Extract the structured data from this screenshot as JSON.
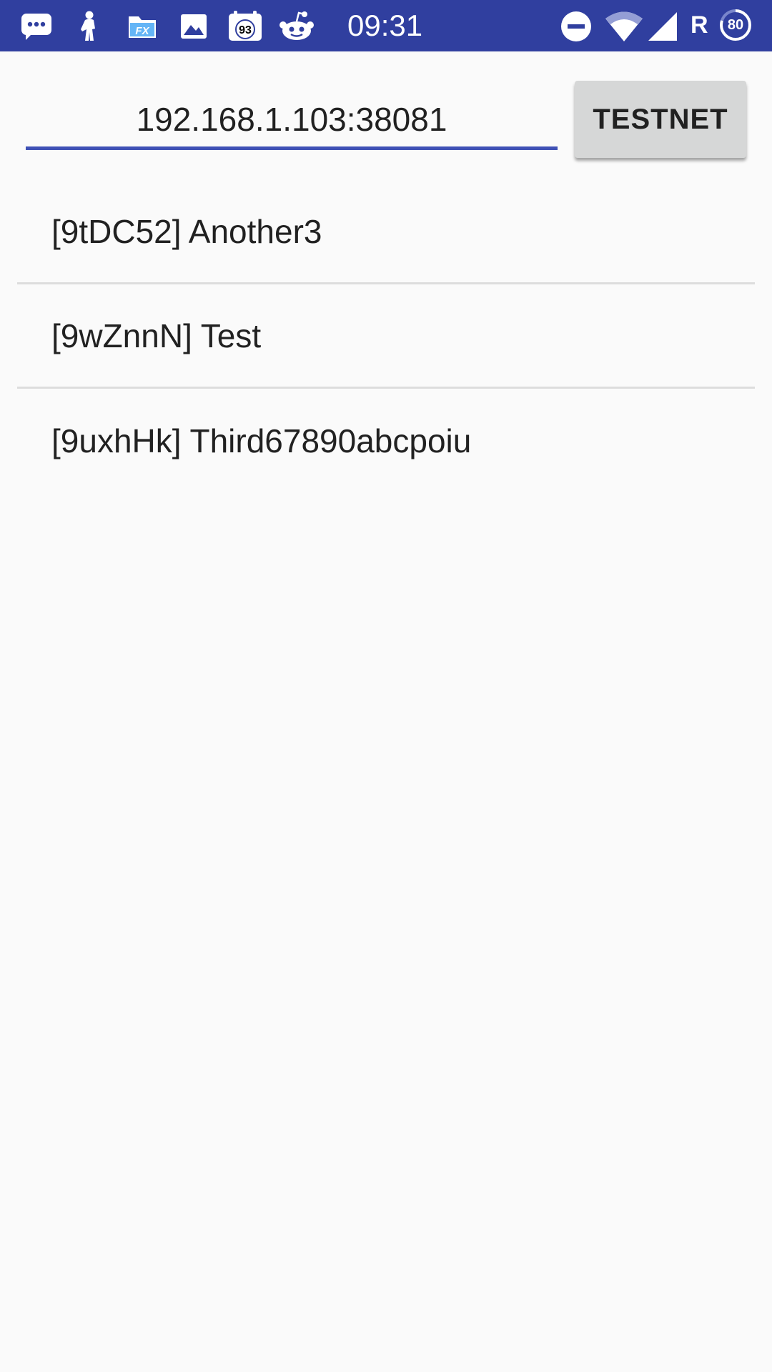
{
  "status_bar": {
    "time": "09:31",
    "notification_badge": "93",
    "roaming_indicator": "R",
    "battery_level": "80",
    "background_color": "#303F9F",
    "icons": [
      "chat-bubble-icon",
      "person-icon",
      "file-manager-icon",
      "image-icon",
      "calendar-icon",
      "reddit-icon",
      "do-not-disturb-icon",
      "wifi-icon",
      "signal-icon",
      "battery-icon"
    ]
  },
  "host_field": {
    "value": "192.168.1.103:38081"
  },
  "network_button": {
    "label": "TESTNET"
  },
  "wallets": [
    {
      "label": "[9tDC52] Another3"
    },
    {
      "label": "[9wZnnN] Test"
    },
    {
      "label": "[9uxhHk] Third67890abcpoiu"
    }
  ],
  "colors": {
    "accent": "#3F51B5",
    "background": "#FAFAFA",
    "button_bg": "#D6D7D7",
    "divider": "#DDDDDD"
  }
}
